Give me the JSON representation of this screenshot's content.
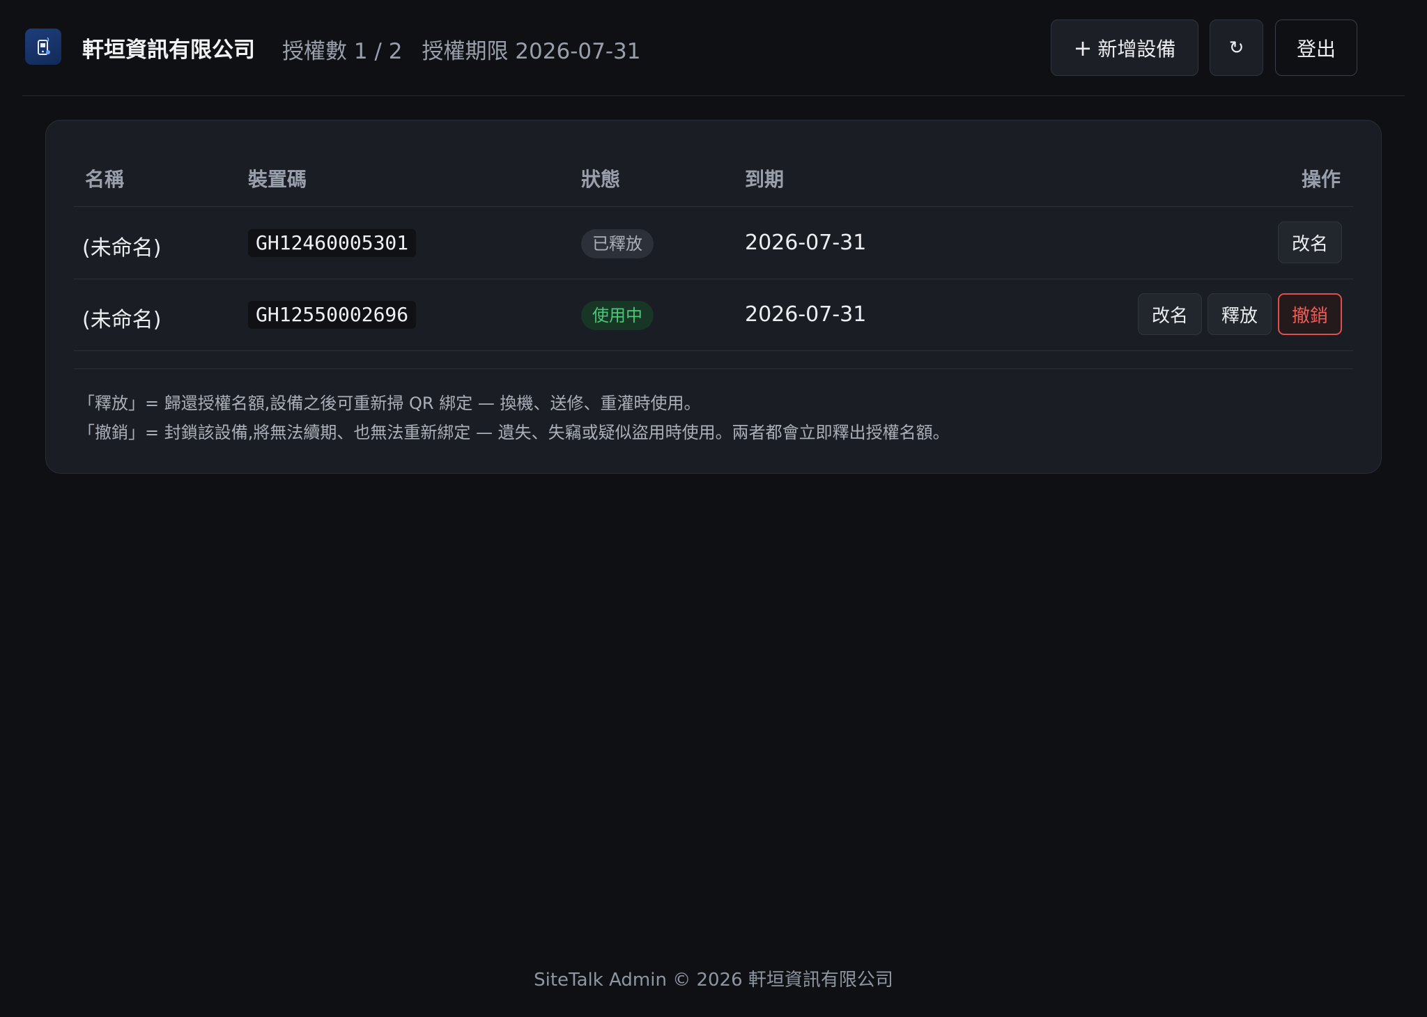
{
  "header": {
    "company": "軒垣資訊有限公司",
    "license_count": "授權數 1 / 2",
    "license_expiry": "授權期限 2026-07-31",
    "add_button": "新增設備",
    "add_icon": "plus-icon",
    "refresh_button": "↻",
    "logout_button": "登出",
    "logo_icon": "phone-app-icon"
  },
  "table": {
    "columns": [
      "名稱",
      "裝置碼",
      "狀態",
      "到期",
      "操作"
    ],
    "rows": [
      {
        "name": "(未命名)",
        "device_code": "GH12460005301",
        "status": "已釋放",
        "expiry": "2026-07-31",
        "actions": [
          "改名"
        ]
      },
      {
        "name": "(未命名)",
        "device_code": "GH12550002696",
        "status": "使用中",
        "expiry": "2026-07-31",
        "actions": [
          "改名",
          "釋放",
          "撤銷"
        ]
      }
    ]
  },
  "notes": [
    "「釋放」= 歸還授權名額,設備之後可重新掃 QR 綁定 — 換機、送修、重灌時使用。",
    "「撤銷」= 封鎖該設備,將無法續期、也無法重新綁定 — 遺失、失竊或疑似盜用時使用。兩者都會立即釋出授權名額。"
  ],
  "footer": "SiteTalk Admin © 2026 軒垣資訊有限公司",
  "colors": {
    "background": "#0e1014",
    "card": "#1a1d23",
    "status_active": "#4cc778",
    "danger": "#e0504a"
  }
}
